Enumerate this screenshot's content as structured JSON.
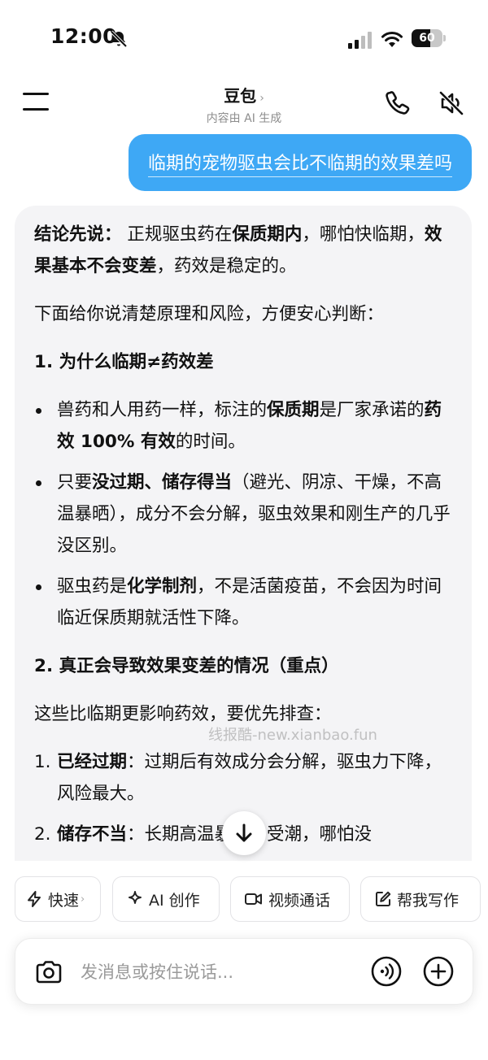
{
  "status_bar": {
    "time": "12:00",
    "battery_level": "60",
    "battery_fraction": 0.6
  },
  "header": {
    "title": "豆包",
    "chevron": "›",
    "subtitle": "内容由 AI 生成",
    "icons": [
      "menu-icon",
      "phone-icon",
      "speaker-mute-icon"
    ]
  },
  "user_message": "临期的宠物驱虫会比不临期的效果差吗",
  "answer": {
    "p1_label": "结论先说：",
    "p1_a": " 正规驱虫药在",
    "p1_b": "保质期内",
    "p1_c": "，哪怕快临期，",
    "p1_d": "效果基本不会变差",
    "p1_e": "，药效是稳定的。",
    "p2": "下面给你说清楚原理和风险，方便安心判断：",
    "h1": "1. 为什么临期≠药效差",
    "b1_a": "兽药和人用药一样，标注的",
    "b1_b": "保质期",
    "b1_c": "是厂家承诺的",
    "b1_d": "药效 100% 有效",
    "b1_e": "的时间。",
    "b2_a": "只要",
    "b2_b": "没过期、储存得当",
    "b2_c": "（避光、阴凉、干燥，不高温暴晒），成分不会分解，驱虫效果和刚生产的几乎没区别。",
    "b3_a": "驱虫药是",
    "b3_b": "化学制剂",
    "b3_c": "，不是活菌疫苗，不会因为时间临近保质期就活性下降。",
    "h2": "2. 真正会导致效果变差的情况（重点）",
    "p3": "这些比临期更影响药效，要优先排查：",
    "o1_num": "1.",
    "o1_b": "已经过期",
    "o1_c": "：过期后有效成分会分解，驱虫力下降，风险最大。",
    "o2_num": "2.",
    "o2_b": "储存不当",
    "o2_c": "：长期高温暴晒、受潮，哪怕没"
  },
  "watermark": "线报酷-new.xianbao.fun",
  "quick_actions": {
    "fast": "快速",
    "fast_chevron": "›",
    "ai_create": "AI 创作",
    "video_call": "视频通话",
    "help_write": "帮我写作"
  },
  "input": {
    "placeholder": "发消息或按住说话..."
  },
  "colors": {
    "user_bubble": "#3ea8f5",
    "card_bg": "#f4f4f6"
  }
}
